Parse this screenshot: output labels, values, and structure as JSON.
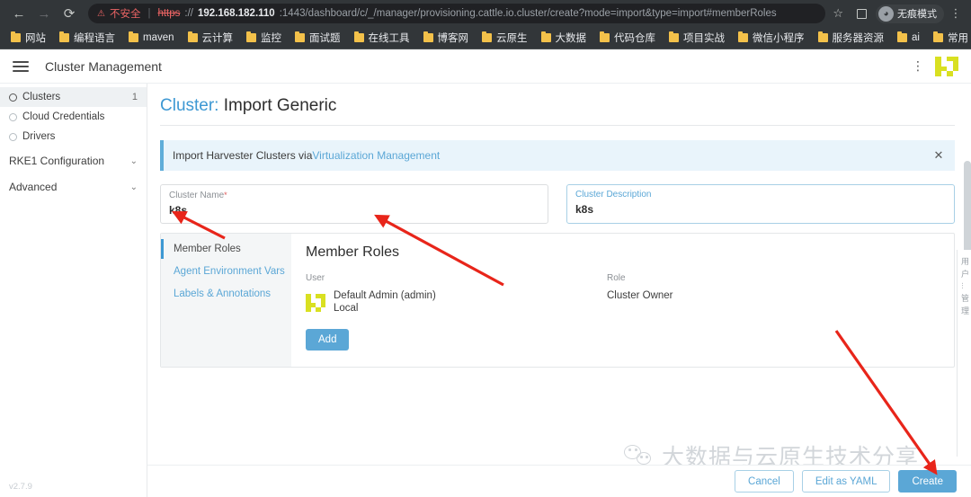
{
  "browser": {
    "back_icon": "back-arrow-icon",
    "forward_icon": "forward-arrow-icon",
    "reload_icon": "reload-icon",
    "security_warning_icon": "warning-triangle-icon",
    "security_label": "不安全",
    "url_scheme": "https",
    "url_separator": "://",
    "url_host": "192.168.182.110",
    "url_rest": ":1443/dashboard/c/_/manager/provisioning.cattle.io.cluster/create?mode=import&type=import#memberRoles",
    "bookmark_star": "☆",
    "extension_icon": "extensions-icon",
    "incognito_label": "无痕模式",
    "menu_icon": "chrome-menu-icon",
    "bookmarks": [
      "网站",
      "编程语言",
      "maven",
      "云计算",
      "监控",
      "面试题",
      "在线工具",
      "博客网",
      "云原生",
      "大数据",
      "代码仓库",
      "项目实战",
      "微信小程序",
      "服务器资源",
      "ai",
      "常用"
    ]
  },
  "app": {
    "header": {
      "title": "Cluster Management",
      "menu_icon": "vertical-dots-icon",
      "avatar": "user-identicon"
    },
    "sidebar": {
      "items": [
        {
          "label": "Clusters",
          "count": "1",
          "active": true,
          "sub": false
        },
        {
          "label": "Cloud Credentials",
          "count": "",
          "active": false,
          "sub": true
        },
        {
          "label": "Drivers",
          "count": "",
          "active": false,
          "sub": true
        }
      ],
      "groups": [
        {
          "label": "RKE1 Configuration",
          "chevron": "⌄"
        },
        {
          "label": "Advanced",
          "chevron": "⌄"
        }
      ],
      "version": "v2.7.9"
    },
    "page": {
      "title_lead": "Cluster:",
      "title_main": "Import Generic"
    },
    "banner": {
      "text_before": "Import Harvester Clusters via ",
      "link_text": "Virtualization Management",
      "close_icon": "close-icon"
    },
    "form": {
      "cluster_name": {
        "label": "Cluster Name",
        "required_marker": "*",
        "value": "k8s",
        "placeholder": ""
      },
      "cluster_description": {
        "label": "Cluster Description",
        "value": "k8s",
        "placeholder": ""
      }
    },
    "tabs": [
      {
        "label": "Member Roles",
        "active": true
      },
      {
        "label": "Agent Environment Vars",
        "active": false
      },
      {
        "label": "Labels & Annotations",
        "active": false
      }
    ],
    "member_roles": {
      "heading": "Member Roles",
      "col_user": "User",
      "col_role": "Role",
      "user_primary": "Default Admin (admin)",
      "user_secondary": "Local",
      "role_value": "Cluster Owner",
      "add_label": "Add"
    },
    "footer": {
      "cancel": "Cancel",
      "edit_yaml": "Edit as YAML",
      "create": "Create"
    },
    "edge_strip": [
      "用",
      "户",
      "...",
      "管",
      "理"
    ]
  },
  "watermark": {
    "text": "大数据与云原生技术分享",
    "icon": "wechat-icon"
  },
  "colors": {
    "accent_blue": "#5ba7d6",
    "link_blue": "#3d98d3",
    "banner_bg": "#e9f4fb",
    "identicon_yellow": "#d9e021",
    "annotation_red": "#e8251a",
    "chrome_bg": "#323639"
  }
}
